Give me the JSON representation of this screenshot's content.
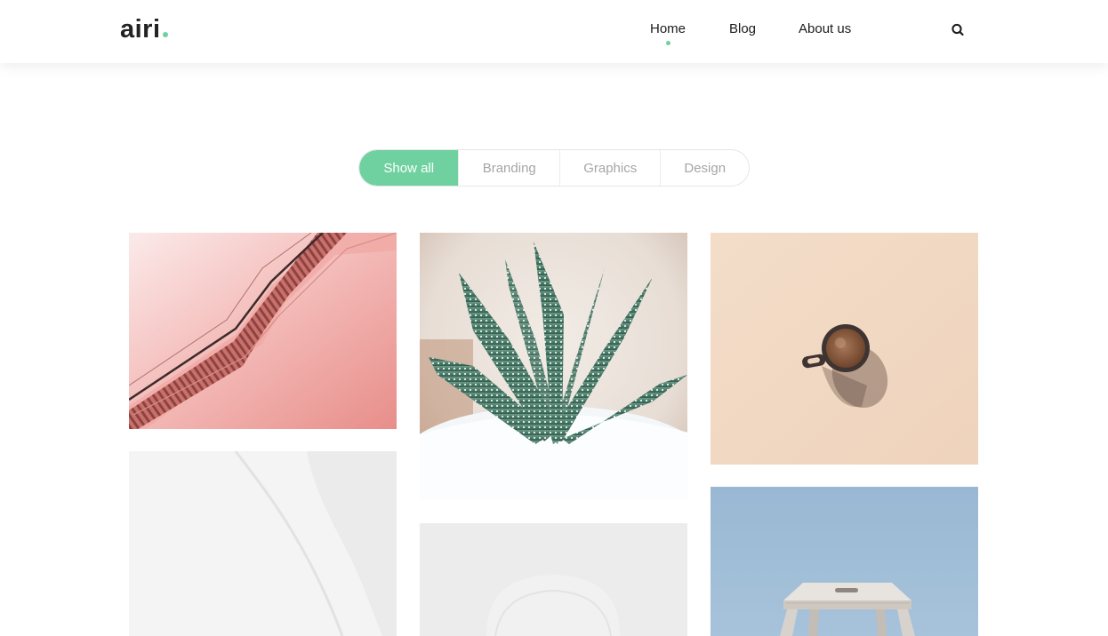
{
  "brand": {
    "logo_text": "airi",
    "accent_color": "#6fd1a0"
  },
  "nav": {
    "items": [
      {
        "label": "Home",
        "active": true
      },
      {
        "label": "Blog",
        "active": false
      },
      {
        "label": "About us",
        "active": false
      }
    ],
    "search_icon": "search-icon"
  },
  "filters": {
    "items": [
      {
        "label": "Show all",
        "active": true
      },
      {
        "label": "Branding",
        "active": false
      },
      {
        "label": "Graphics",
        "active": false
      },
      {
        "label": "Design",
        "active": false
      }
    ]
  },
  "portfolio": {
    "tiles": [
      {
        "subject": "pink escalator"
      },
      {
        "subject": "aloe plant in white pot"
      },
      {
        "subject": "coffee cup on beige background"
      },
      {
        "subject": "white chair"
      },
      {
        "subject": "white chair"
      },
      {
        "subject": "wooden stool on blue background"
      }
    ]
  }
}
